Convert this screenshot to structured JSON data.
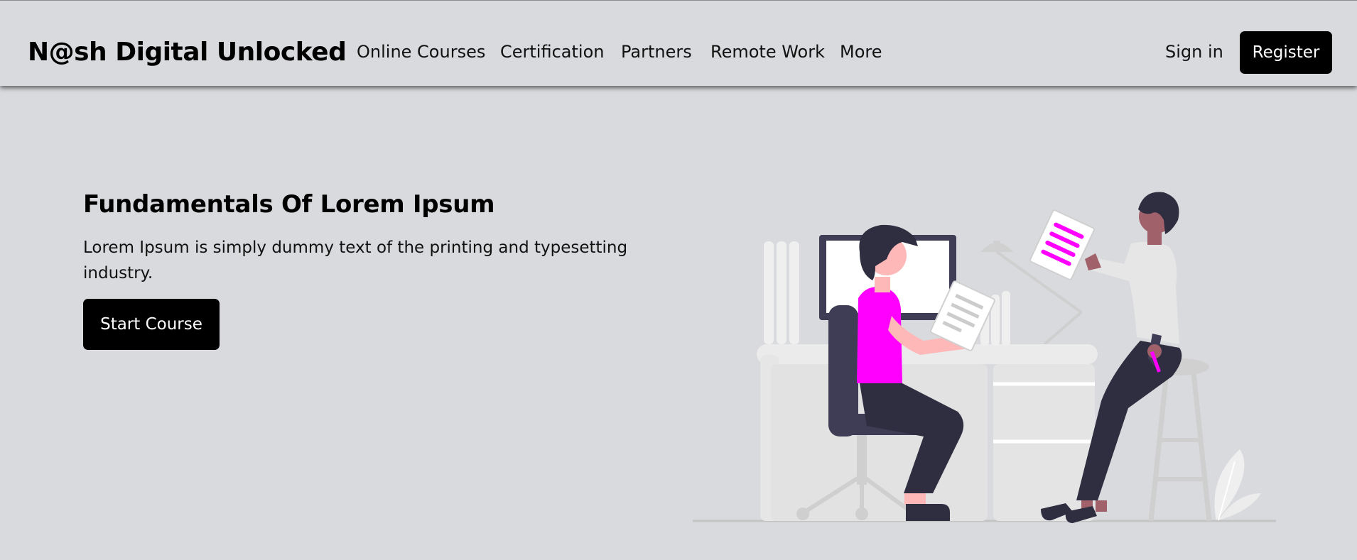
{
  "header": {
    "brand": "N@sh Digital Unlocked",
    "nav": [
      {
        "label": "Online Courses"
      },
      {
        "label": "Certification"
      },
      {
        "label": "Partners"
      },
      {
        "label": "Remote Work"
      },
      {
        "label": "More"
      }
    ],
    "sign_in": "Sign in",
    "register": "Register"
  },
  "hero": {
    "title": "Fundamentals Of Lorem Ipsum",
    "description": "Lorem Ipsum is simply dummy text of the printing and typesetting industry.",
    "cta": "Start Course"
  },
  "colors": {
    "background": "#d9dadd",
    "accent": "#ff00ff",
    "button": "#000000"
  },
  "icons": {
    "hero_illustration": "office-workers-illustration"
  }
}
